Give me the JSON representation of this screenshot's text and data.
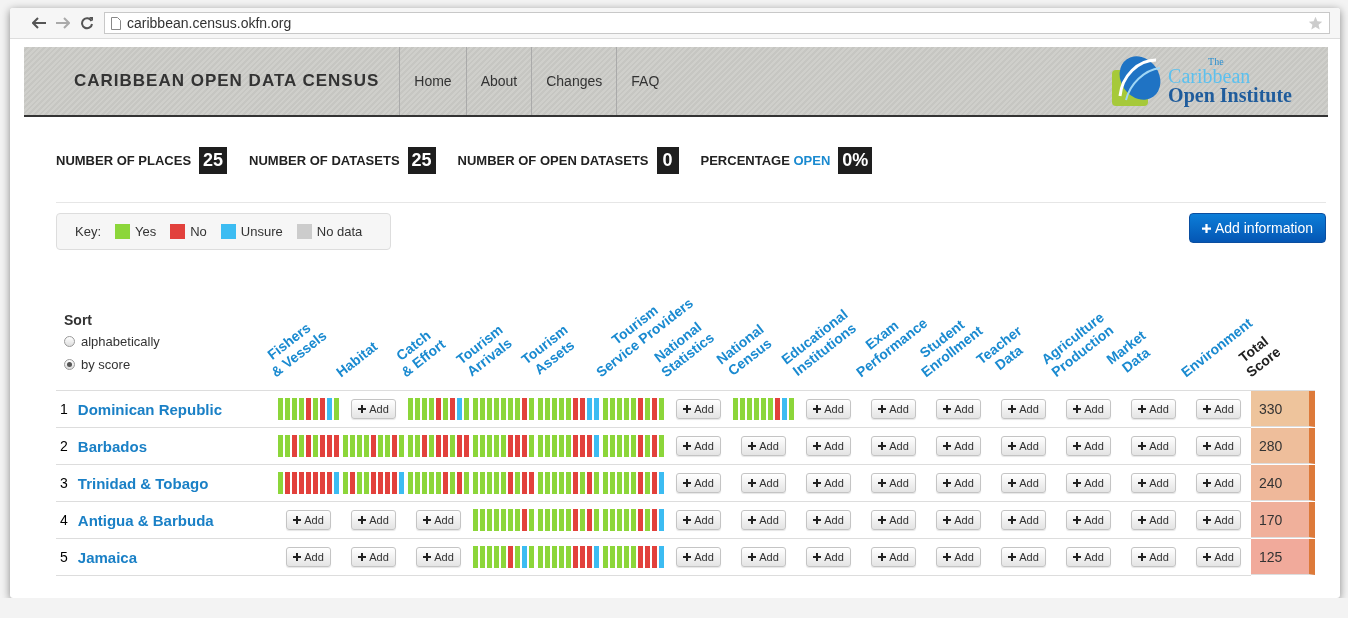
{
  "browser": {
    "url": "caribbean.census.okfn.org"
  },
  "header": {
    "title": "CARIBBEAN OPEN DATA CENSUS",
    "nav": [
      "Home",
      "About",
      "Changes",
      "FAQ"
    ],
    "logo": {
      "small": "The",
      "line1": "Caribbean",
      "line2": "Open Institute"
    }
  },
  "stats": [
    {
      "label": "NUMBER OF PLACES",
      "value": "25"
    },
    {
      "label": "NUMBER OF DATASETS",
      "value": "25"
    },
    {
      "label": "NUMBER OF OPEN DATASETS",
      "value": "0"
    },
    {
      "label": "PERCENTAGE",
      "highlight": "OPEN",
      "value": "0%"
    }
  ],
  "key": {
    "label": "Key:",
    "items": [
      {
        "label": "Yes",
        "color": "#8cd63a"
      },
      {
        "label": "No",
        "color": "#e2413c"
      },
      {
        "label": "Unsure",
        "color": "#3cbcf2"
      },
      {
        "label": "No data",
        "color": "#cccccc"
      }
    ]
  },
  "add_button": "Add information",
  "sort": {
    "title": "Sort",
    "options": [
      {
        "label": "alphabetically",
        "selected": false
      },
      {
        "label": "by score",
        "selected": true
      }
    ]
  },
  "columns": [
    [
      "Fishers",
      "& Vessels"
    ],
    [
      "Habitat"
    ],
    [
      "Catch",
      "& Effort"
    ],
    [
      "Tourism",
      "Arrivals"
    ],
    [
      "Tourism",
      "Assets"
    ],
    [
      "Tourism",
      "Service Providers"
    ],
    [
      "National",
      "Statistics"
    ],
    [
      "National",
      "Census"
    ],
    [
      "Educational",
      "Institutions"
    ],
    [
      "Exam",
      "Performance"
    ],
    [
      "Student",
      "Enrollment"
    ],
    [
      "Teacher",
      "Data"
    ],
    [
      "Agriculture",
      "Production"
    ],
    [
      "Market",
      "Data"
    ],
    [
      "Environment"
    ]
  ],
  "total_column": [
    "Total",
    "Score"
  ],
  "rows": [
    {
      "rank": "1",
      "name": "Dominican Republic",
      "score": "330",
      "color": "#eec49c",
      "cells": [
        {
          "kind": "bars",
          "bars": [
            {
              "color": "#8cd63a"
            },
            {
              "color": "#8cd63a"
            },
            {
              "color": "#8cd63a"
            },
            {
              "color": "#8cd63a"
            },
            {
              "color": "#e2413c"
            },
            {
              "color": "#8cd63a"
            },
            {
              "color": "#e2413c"
            },
            {
              "color": "#3cbcf2"
            },
            {
              "color": "#8cd63a"
            }
          ]
        },
        {
          "kind": "add",
          "label": "Add"
        },
        {
          "kind": "bars",
          "bars": [
            {
              "color": "#8cd63a"
            },
            {
              "color": "#8cd63a"
            },
            {
              "color": "#8cd63a"
            },
            {
              "color": "#8cd63a"
            },
            {
              "color": "#e2413c"
            },
            {
              "color": "#8cd63a"
            },
            {
              "color": "#e2413c"
            },
            {
              "color": "#3cbcf2"
            },
            {
              "color": "#8cd63a"
            }
          ]
        },
        {
          "kind": "bars",
          "bars": [
            {
              "color": "#8cd63a"
            },
            {
              "color": "#8cd63a"
            },
            {
              "color": "#8cd63a"
            },
            {
              "color": "#8cd63a"
            },
            {
              "color": "#8cd63a"
            },
            {
              "color": "#8cd63a"
            },
            {
              "color": "#8cd63a"
            },
            {
              "color": "#e2413c"
            },
            {
              "color": "#8cd63a"
            }
          ]
        },
        {
          "kind": "bars",
          "bars": [
            {
              "color": "#8cd63a"
            },
            {
              "color": "#8cd63a"
            },
            {
              "color": "#8cd63a"
            },
            {
              "color": "#8cd63a"
            },
            {
              "color": "#8cd63a"
            },
            {
              "color": "#e2413c"
            },
            {
              "color": "#e2413c"
            },
            {
              "color": "#3cbcf2"
            },
            {
              "color": "#3cbcf2"
            }
          ]
        },
        {
          "kind": "bars",
          "bars": [
            {
              "color": "#8cd63a"
            },
            {
              "color": "#8cd63a"
            },
            {
              "color": "#8cd63a"
            },
            {
              "color": "#8cd63a"
            },
            {
              "color": "#8cd63a"
            },
            {
              "color": "#e2413c"
            },
            {
              "color": "#8cd63a"
            },
            {
              "color": "#e2413c"
            },
            {
              "color": "#8cd63a"
            }
          ]
        },
        {
          "kind": "add",
          "label": "Add"
        },
        {
          "kind": "bars",
          "bars": [
            {
              "color": "#8cd63a"
            },
            {
              "color": "#8cd63a"
            },
            {
              "color": "#8cd63a"
            },
            {
              "color": "#8cd63a"
            },
            {
              "color": "#8cd63a"
            },
            {
              "color": "#8cd63a"
            },
            {
              "color": "#e2413c"
            },
            {
              "color": "#3cbcf2"
            },
            {
              "color": "#8cd63a"
            }
          ]
        },
        {
          "kind": "add",
          "label": "Add"
        },
        {
          "kind": "add",
          "label": "Add"
        },
        {
          "kind": "add",
          "label": "Add"
        },
        {
          "kind": "add",
          "label": "Add"
        },
        {
          "kind": "add",
          "label": "Add"
        },
        {
          "kind": "add",
          "label": "Add"
        },
        {
          "kind": "add",
          "label": "Add"
        }
      ]
    },
    {
      "rank": "2",
      "name": "Barbados",
      "score": "280",
      "color": "#eebe9b",
      "cells": [
        {
          "kind": "bars",
          "bars": [
            {
              "color": "#8cd63a"
            },
            {
              "color": "#8cd63a"
            },
            {
              "color": "#e2413c"
            },
            {
              "color": "#8cd63a"
            },
            {
              "color": "#e2413c"
            },
            {
              "color": "#8cd63a"
            },
            {
              "color": "#e2413c"
            },
            {
              "color": "#e2413c"
            },
            {
              "color": "#e2413c"
            }
          ]
        },
        {
          "kind": "bars",
          "bars": [
            {
              "color": "#8cd63a"
            },
            {
              "color": "#8cd63a"
            },
            {
              "color": "#8cd63a"
            },
            {
              "color": "#8cd63a"
            },
            {
              "color": "#e2413c"
            },
            {
              "color": "#8cd63a"
            },
            {
              "color": "#8cd63a"
            },
            {
              "color": "#e2413c"
            },
            {
              "color": "#8cd63a"
            }
          ]
        },
        {
          "kind": "bars",
          "bars": [
            {
              "color": "#8cd63a"
            },
            {
              "color": "#8cd63a"
            },
            {
              "color": "#e2413c"
            },
            {
              "color": "#8cd63a"
            },
            {
              "color": "#e2413c"
            },
            {
              "color": "#e2413c"
            },
            {
              "color": "#8cd63a"
            },
            {
              "color": "#e2413c"
            },
            {
              "color": "#e2413c"
            }
          ]
        },
        {
          "kind": "bars",
          "bars": [
            {
              "color": "#8cd63a"
            },
            {
              "color": "#8cd63a"
            },
            {
              "color": "#8cd63a"
            },
            {
              "color": "#8cd63a"
            },
            {
              "color": "#8cd63a"
            },
            {
              "color": "#e2413c"
            },
            {
              "color": "#e2413c"
            },
            {
              "color": "#e2413c"
            },
            {
              "color": "#8cd63a"
            }
          ]
        },
        {
          "kind": "bars",
          "bars": [
            {
              "color": "#8cd63a"
            },
            {
              "color": "#8cd63a"
            },
            {
              "color": "#8cd63a"
            },
            {
              "color": "#8cd63a"
            },
            {
              "color": "#8cd63a"
            },
            {
              "color": "#e2413c"
            },
            {
              "color": "#e2413c"
            },
            {
              "color": "#e2413c"
            },
            {
              "color": "#3cbcf2"
            }
          ]
        },
        {
          "kind": "bars",
          "bars": [
            {
              "color": "#8cd63a"
            },
            {
              "color": "#8cd63a"
            },
            {
              "color": "#8cd63a"
            },
            {
              "color": "#8cd63a"
            },
            {
              "color": "#8cd63a"
            },
            {
              "color": "#e2413c"
            },
            {
              "color": "#8cd63a"
            },
            {
              "color": "#e2413c"
            },
            {
              "color": "#8cd63a"
            }
          ]
        },
        {
          "kind": "add",
          "label": "Add"
        },
        {
          "kind": "add",
          "label": "Add"
        },
        {
          "kind": "add",
          "label": "Add"
        },
        {
          "kind": "add",
          "label": "Add"
        },
        {
          "kind": "add",
          "label": "Add"
        },
        {
          "kind": "add",
          "label": "Add"
        },
        {
          "kind": "add",
          "label": "Add"
        },
        {
          "kind": "add",
          "label": "Add"
        },
        {
          "kind": "add",
          "label": "Add"
        }
      ]
    },
    {
      "rank": "3",
      "name": "Trinidad & Tobago",
      "score": "240",
      "color": "#efb89a",
      "cells": [
        {
          "kind": "bars",
          "bars": [
            {
              "color": "#8cd63a"
            },
            {
              "color": "#e2413c"
            },
            {
              "color": "#e2413c"
            },
            {
              "color": "#e2413c"
            },
            {
              "color": "#e2413c"
            },
            {
              "color": "#e2413c"
            },
            {
              "color": "#e2413c"
            },
            {
              "color": "#e2413c"
            },
            {
              "color": "#3cbcf2"
            }
          ]
        },
        {
          "kind": "bars",
          "bars": [
            {
              "color": "#8cd63a"
            },
            {
              "color": "#e2413c"
            },
            {
              "color": "#8cd63a"
            },
            {
              "color": "#8cd63a"
            },
            {
              "color": "#e2413c"
            },
            {
              "color": "#e2413c"
            },
            {
              "color": "#e2413c"
            },
            {
              "color": "#e2413c"
            },
            {
              "color": "#3cbcf2"
            }
          ]
        },
        {
          "kind": "bars",
          "bars": [
            {
              "color": "#8cd63a"
            },
            {
              "color": "#8cd63a"
            },
            {
              "color": "#8cd63a"
            },
            {
              "color": "#8cd63a"
            },
            {
              "color": "#8cd63a"
            },
            {
              "color": "#e2413c"
            },
            {
              "color": "#8cd63a"
            },
            {
              "color": "#e2413c"
            },
            {
              "color": "#8cd63a"
            }
          ]
        },
        {
          "kind": "bars",
          "bars": [
            {
              "color": "#8cd63a"
            },
            {
              "color": "#8cd63a"
            },
            {
              "color": "#8cd63a"
            },
            {
              "color": "#8cd63a"
            },
            {
              "color": "#8cd63a"
            },
            {
              "color": "#e2413c"
            },
            {
              "color": "#8cd63a"
            },
            {
              "color": "#e2413c"
            },
            {
              "color": "#e2413c"
            }
          ]
        },
        {
          "kind": "bars",
          "bars": [
            {
              "color": "#8cd63a"
            },
            {
              "color": "#8cd63a"
            },
            {
              "color": "#8cd63a"
            },
            {
              "color": "#8cd63a"
            },
            {
              "color": "#8cd63a"
            },
            {
              "color": "#e2413c"
            },
            {
              "color": "#8cd63a"
            },
            {
              "color": "#e2413c"
            },
            {
              "color": "#8cd63a"
            }
          ]
        },
        {
          "kind": "bars",
          "bars": [
            {
              "color": "#8cd63a"
            },
            {
              "color": "#8cd63a"
            },
            {
              "color": "#8cd63a"
            },
            {
              "color": "#8cd63a"
            },
            {
              "color": "#8cd63a"
            },
            {
              "color": "#e2413c"
            },
            {
              "color": "#8cd63a"
            },
            {
              "color": "#e2413c"
            },
            {
              "color": "#3cbcf2"
            }
          ]
        },
        {
          "kind": "add",
          "label": "Add"
        },
        {
          "kind": "add",
          "label": "Add"
        },
        {
          "kind": "add",
          "label": "Add"
        },
        {
          "kind": "add",
          "label": "Add"
        },
        {
          "kind": "add",
          "label": "Add"
        },
        {
          "kind": "add",
          "label": "Add"
        },
        {
          "kind": "add",
          "label": "Add"
        },
        {
          "kind": "add",
          "label": "Add"
        },
        {
          "kind": "add",
          "label": "Add"
        }
      ]
    },
    {
      "rank": "4",
      "name": "Antigua & Barbuda",
      "score": "170",
      "color": "#f0b09b",
      "cells": [
        {
          "kind": "add",
          "label": "Add"
        },
        {
          "kind": "add",
          "label": "Add"
        },
        {
          "kind": "add",
          "label": "Add"
        },
        {
          "kind": "bars",
          "bars": [
            {
              "color": "#8cd63a"
            },
            {
              "color": "#8cd63a"
            },
            {
              "color": "#8cd63a"
            },
            {
              "color": "#8cd63a"
            },
            {
              "color": "#8cd63a"
            },
            {
              "color": "#8cd63a"
            },
            {
              "color": "#8cd63a"
            },
            {
              "color": "#e2413c"
            },
            {
              "color": "#8cd63a"
            }
          ]
        },
        {
          "kind": "bars",
          "bars": [
            {
              "color": "#8cd63a"
            },
            {
              "color": "#8cd63a"
            },
            {
              "color": "#8cd63a"
            },
            {
              "color": "#8cd63a"
            },
            {
              "color": "#8cd63a"
            },
            {
              "color": "#e2413c"
            },
            {
              "color": "#8cd63a"
            },
            {
              "color": "#e2413c"
            },
            {
              "color": "#8cd63a"
            }
          ]
        },
        {
          "kind": "bars",
          "bars": [
            {
              "color": "#8cd63a"
            },
            {
              "color": "#8cd63a"
            },
            {
              "color": "#8cd63a"
            },
            {
              "color": "#8cd63a"
            },
            {
              "color": "#8cd63a"
            },
            {
              "color": "#e2413c"
            },
            {
              "color": "#8cd63a"
            },
            {
              "color": "#e2413c"
            },
            {
              "color": "#3cbcf2"
            }
          ]
        },
        {
          "kind": "add",
          "label": "Add"
        },
        {
          "kind": "add",
          "label": "Add"
        },
        {
          "kind": "add",
          "label": "Add"
        },
        {
          "kind": "add",
          "label": "Add"
        },
        {
          "kind": "add",
          "label": "Add"
        },
        {
          "kind": "add",
          "label": "Add"
        },
        {
          "kind": "add",
          "label": "Add"
        },
        {
          "kind": "add",
          "label": "Add"
        },
        {
          "kind": "add",
          "label": "Add"
        }
      ]
    },
    {
      "rank": "5",
      "name": "Jamaica",
      "score": "125",
      "color": "#f1aa9b",
      "cells": [
        {
          "kind": "add",
          "label": "Add"
        },
        {
          "kind": "add",
          "label": "Add"
        },
        {
          "kind": "add",
          "label": "Add"
        },
        {
          "kind": "bars",
          "bars": [
            {
              "color": "#8cd63a"
            },
            {
              "color": "#8cd63a"
            },
            {
              "color": "#8cd63a"
            },
            {
              "color": "#8cd63a"
            },
            {
              "color": "#8cd63a"
            },
            {
              "color": "#e2413c"
            },
            {
              "color": "#8cd63a"
            },
            {
              "color": "#3cbcf2"
            },
            {
              "color": "#8cd63a"
            }
          ]
        },
        {
          "kind": "bars",
          "bars": [
            {
              "color": "#8cd63a"
            },
            {
              "color": "#8cd63a"
            },
            {
              "color": "#8cd63a"
            },
            {
              "color": "#8cd63a"
            },
            {
              "color": "#8cd63a"
            },
            {
              "color": "#e2413c"
            },
            {
              "color": "#e2413c"
            },
            {
              "color": "#e2413c"
            },
            {
              "color": "#3cbcf2"
            }
          ]
        },
        {
          "kind": "bars",
          "bars": [
            {
              "color": "#8cd63a"
            },
            {
              "color": "#8cd63a"
            },
            {
              "color": "#8cd63a"
            },
            {
              "color": "#8cd63a"
            },
            {
              "color": "#8cd63a"
            },
            {
              "color": "#e2413c"
            },
            {
              "color": "#e2413c"
            },
            {
              "color": "#e2413c"
            },
            {
              "color": "#3cbcf2"
            }
          ]
        },
        {
          "kind": "add",
          "label": "Add"
        },
        {
          "kind": "add",
          "label": "Add"
        },
        {
          "kind": "add",
          "label": "Add"
        },
        {
          "kind": "add",
          "label": "Add"
        },
        {
          "kind": "add",
          "label": "Add"
        },
        {
          "kind": "add",
          "label": "Add"
        },
        {
          "kind": "add",
          "label": "Add"
        },
        {
          "kind": "add",
          "label": "Add"
        },
        {
          "kind": "add",
          "label": "Add"
        }
      ]
    }
  ]
}
